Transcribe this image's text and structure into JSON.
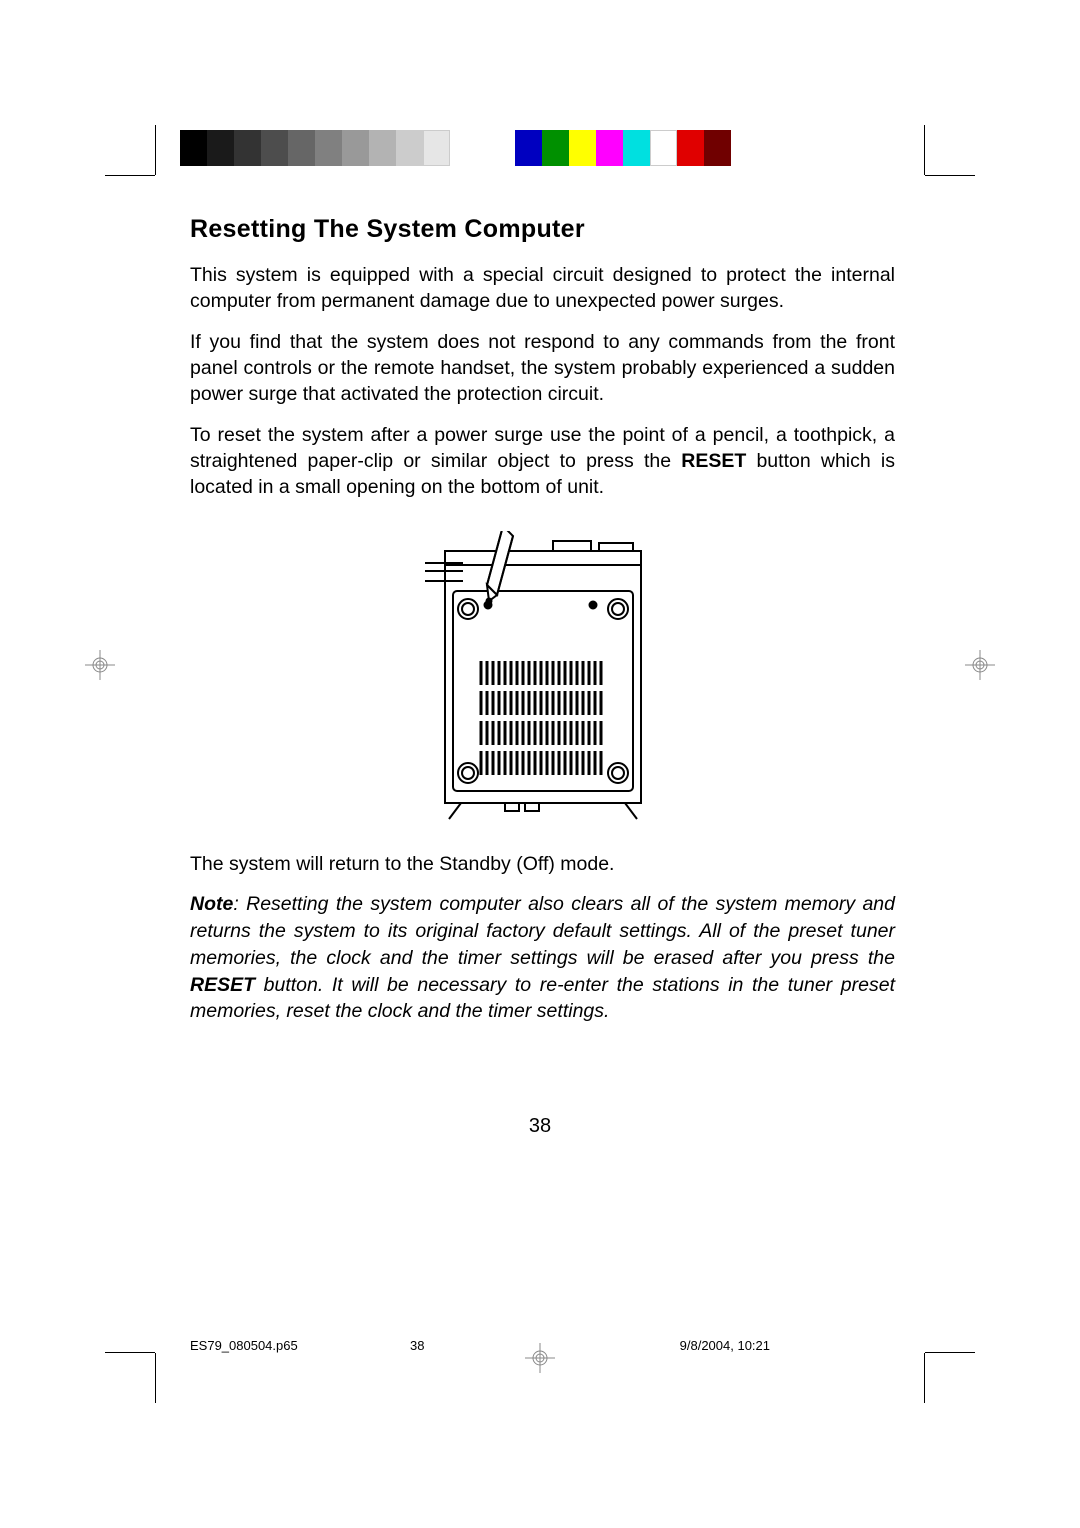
{
  "heading": "Resetting The System Computer",
  "para1": "This system is equipped with a special circuit designed to protect the internal computer from permanent damage due to unexpected power surges.",
  "para2": "If you find that the system does not respond to any commands from the front panel controls or the remote handset, the system probably experienced a sudden power surge that activated the protection circuit.",
  "para3_a": "To reset the system after a power surge use the point of a pencil, a toothpick, a straightened paper-clip or similar object to press the ",
  "para3_b": "RESET",
  "para3_c": " button which is located in a small opening on the bottom of unit.",
  "para4": "The system will return to the Standby (Off) mode.",
  "note_label": "Note",
  "note_a": ": Resetting the system computer also clears all of the system memory and returns the system to its original factory default settings. All of the preset tuner memories, the clock and the timer settings will be erased after you press the ",
  "note_b": "RESET",
  "note_c": " button. It will be necessary to re-enter the stations in the tuner preset memories, reset the clock and the timer settings.",
  "page_number": "38",
  "footer_file": "ES79_080504.p65",
  "footer_page": "38",
  "footer_date": "9/8/2004, 10:21",
  "colors": {
    "gray_swatches": [
      "#000000",
      "#1a1a1a",
      "#333333",
      "#4d4d4d",
      "#666666",
      "#808080",
      "#999999",
      "#b3b3b3",
      "#cccccc",
      "#e6e6e6",
      "#ffffff"
    ],
    "color_swatches": [
      "#0000ff",
      "#00a000",
      "#ffff00",
      "#ff00ff",
      "#00ffff",
      "#ffffff",
      "#ff0000",
      "#800000"
    ]
  }
}
